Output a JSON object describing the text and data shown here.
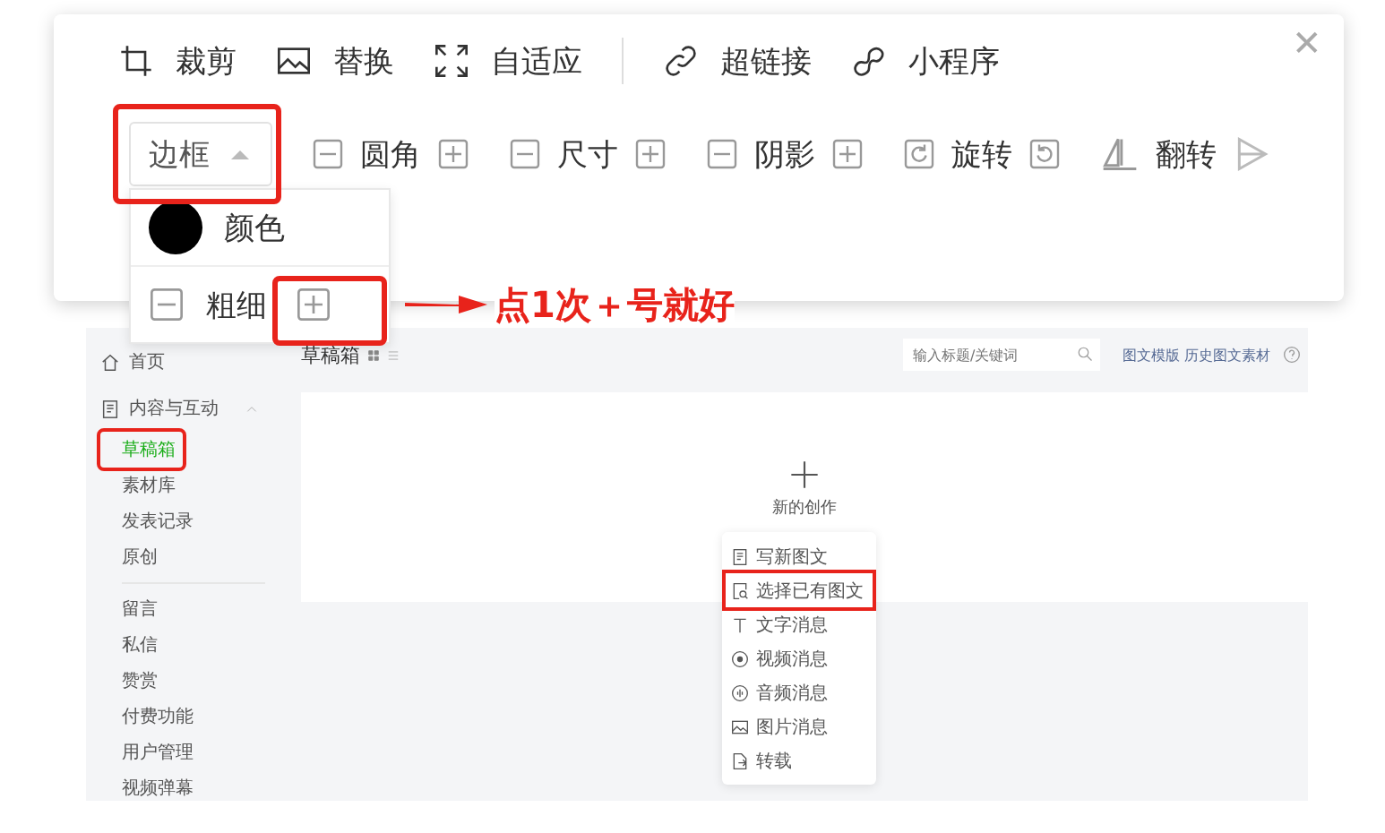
{
  "editor_toolbar": {
    "tools": [
      {
        "kind": "crop",
        "label": "裁剪"
      },
      {
        "kind": "image",
        "label": "替换"
      },
      {
        "kind": "fit",
        "label": "自适应"
      }
    ],
    "links": [
      {
        "kind": "link",
        "label": "超链接"
      },
      {
        "kind": "miniprogram",
        "label": "小程序"
      }
    ],
    "close": "✕",
    "border_dropdown": {
      "label": "边框",
      "expanded": true
    },
    "adjusters": [
      {
        "kind": "stepper",
        "label": "圆角"
      },
      {
        "kind": "stepper",
        "label": "尺寸"
      },
      {
        "kind": "stepper",
        "label": "阴影"
      },
      {
        "kind": "rotate",
        "label": "旋转"
      },
      {
        "kind": "flip",
        "label": "翻转"
      }
    ],
    "border_popup": {
      "color_row": {
        "label": "颜色",
        "color": "#000000"
      },
      "thickness_row": {
        "label": "粗细"
      }
    }
  },
  "annotation": {
    "text": "点1次＋号就好"
  },
  "draft_page": {
    "sidebar": {
      "items": [
        {
          "kind": "home",
          "label": "首页"
        },
        {
          "kind": "doc",
          "label": "内容与互动",
          "expanded": true,
          "children": [
            {
              "label": "草稿箱",
              "selected": true
            },
            {
              "label": "素材库",
              "selected": false
            },
            {
              "label": "发表记录",
              "selected": false
            },
            {
              "label": "原创",
              "selected": false
            }
          ]
        }
      ],
      "more_items": [
        {
          "label": "留言",
          "selected": false
        },
        {
          "label": "私信",
          "selected": false
        },
        {
          "label": "赞赏",
          "selected": false
        },
        {
          "label": "付费功能",
          "selected": false
        },
        {
          "label": "用户管理",
          "selected": false
        },
        {
          "label": "视频弹幕",
          "selected": false
        }
      ]
    },
    "title": "草稿箱",
    "search": {
      "placeholder": "输入标题/关键词"
    },
    "header_link": "图文模版 历史图文素材",
    "new_creation": {
      "label": "新的创作",
      "menu": [
        {
          "kind": "doc",
          "label": "写新图文",
          "highlighted": false
        },
        {
          "kind": "doc-search",
          "label": "选择已有图文",
          "highlighted": true
        },
        {
          "kind": "text",
          "label": "文字消息",
          "highlighted": false
        },
        {
          "kind": "video",
          "label": "视频消息",
          "highlighted": false
        },
        {
          "kind": "audio",
          "label": "音频消息",
          "highlighted": false
        },
        {
          "kind": "image",
          "label": "图片消息",
          "highlighted": false
        },
        {
          "kind": "share",
          "label": "转载",
          "highlighted": false
        }
      ]
    }
  }
}
